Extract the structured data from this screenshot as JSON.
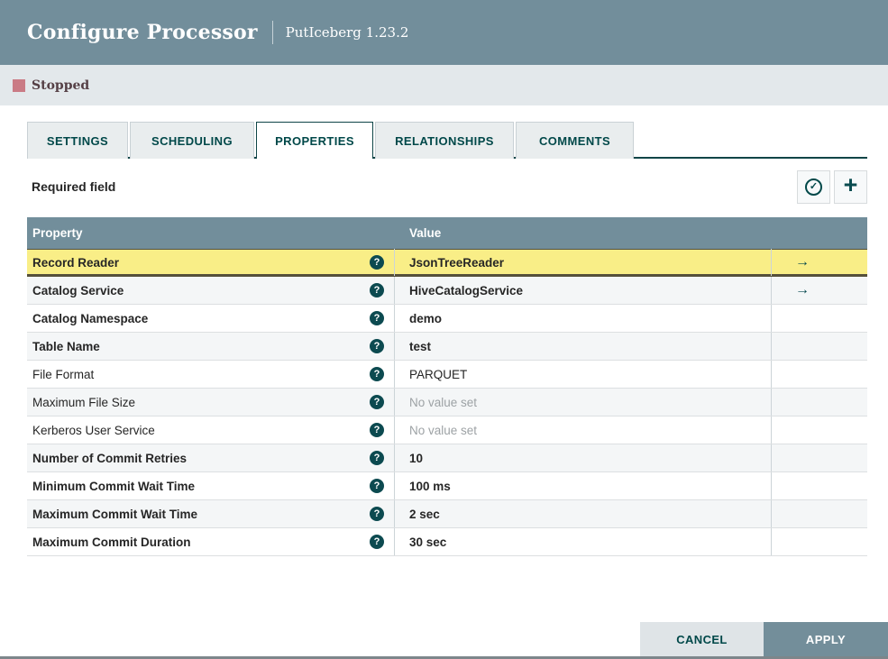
{
  "header": {
    "title": "Configure Processor",
    "subtitle": "PutIceberg 1.23.2"
  },
  "status": {
    "label": "Stopped",
    "state_color": "#ca7b85"
  },
  "tabs": [
    {
      "id": "settings",
      "label": "SETTINGS",
      "active": false
    },
    {
      "id": "scheduling",
      "label": "SCHEDULING",
      "active": false
    },
    {
      "id": "properties",
      "label": "PROPERTIES",
      "active": true
    },
    {
      "id": "relationships",
      "label": "RELATIONSHIPS",
      "active": false
    },
    {
      "id": "comments",
      "label": "COMMENTS",
      "active": false
    }
  ],
  "toolbar": {
    "required_label": "Required field",
    "verify_icon": "check-circle",
    "add_icon": "plus"
  },
  "icons": {
    "help_glyph": "?",
    "check_glyph": "✓",
    "plus_glyph": "+",
    "goto_glyph": "→"
  },
  "table": {
    "columns": [
      "Property",
      "Value"
    ],
    "rows": [
      {
        "property": "Record Reader",
        "value": "JsonTreeReader",
        "required": true,
        "selected": true,
        "unset": false,
        "link": true
      },
      {
        "property": "Catalog Service",
        "value": "HiveCatalogService",
        "required": true,
        "selected": false,
        "unset": false,
        "link": true
      },
      {
        "property": "Catalog Namespace",
        "value": "demo",
        "required": true,
        "selected": false,
        "unset": false,
        "link": false
      },
      {
        "property": "Table Name",
        "value": "test",
        "required": true,
        "selected": false,
        "unset": false,
        "link": false
      },
      {
        "property": "File Format",
        "value": "PARQUET",
        "required": false,
        "selected": false,
        "unset": false,
        "link": false
      },
      {
        "property": "Maximum File Size",
        "value": "No value set",
        "required": false,
        "selected": false,
        "unset": true,
        "link": false
      },
      {
        "property": "Kerberos User Service",
        "value": "No value set",
        "required": false,
        "selected": false,
        "unset": true,
        "link": false
      },
      {
        "property": "Number of Commit Retries",
        "value": "10",
        "required": true,
        "selected": false,
        "unset": false,
        "link": false
      },
      {
        "property": "Minimum Commit Wait Time",
        "value": "100 ms",
        "required": true,
        "selected": false,
        "unset": false,
        "link": false
      },
      {
        "property": "Maximum Commit Wait Time",
        "value": "2 sec",
        "required": true,
        "selected": false,
        "unset": false,
        "link": false
      },
      {
        "property": "Maximum Commit Duration",
        "value": "30 sec",
        "required": true,
        "selected": false,
        "unset": false,
        "link": false
      }
    ]
  },
  "footer": {
    "cancel_label": "CANCEL",
    "apply_label": "APPLY"
  },
  "colors": {
    "header_bg": "#728e9b",
    "status_bg": "#e3e8eb",
    "accent_teal": "#004849",
    "selected_row_bg": "#f9ee87",
    "alt_row_bg": "#f4f6f7"
  }
}
